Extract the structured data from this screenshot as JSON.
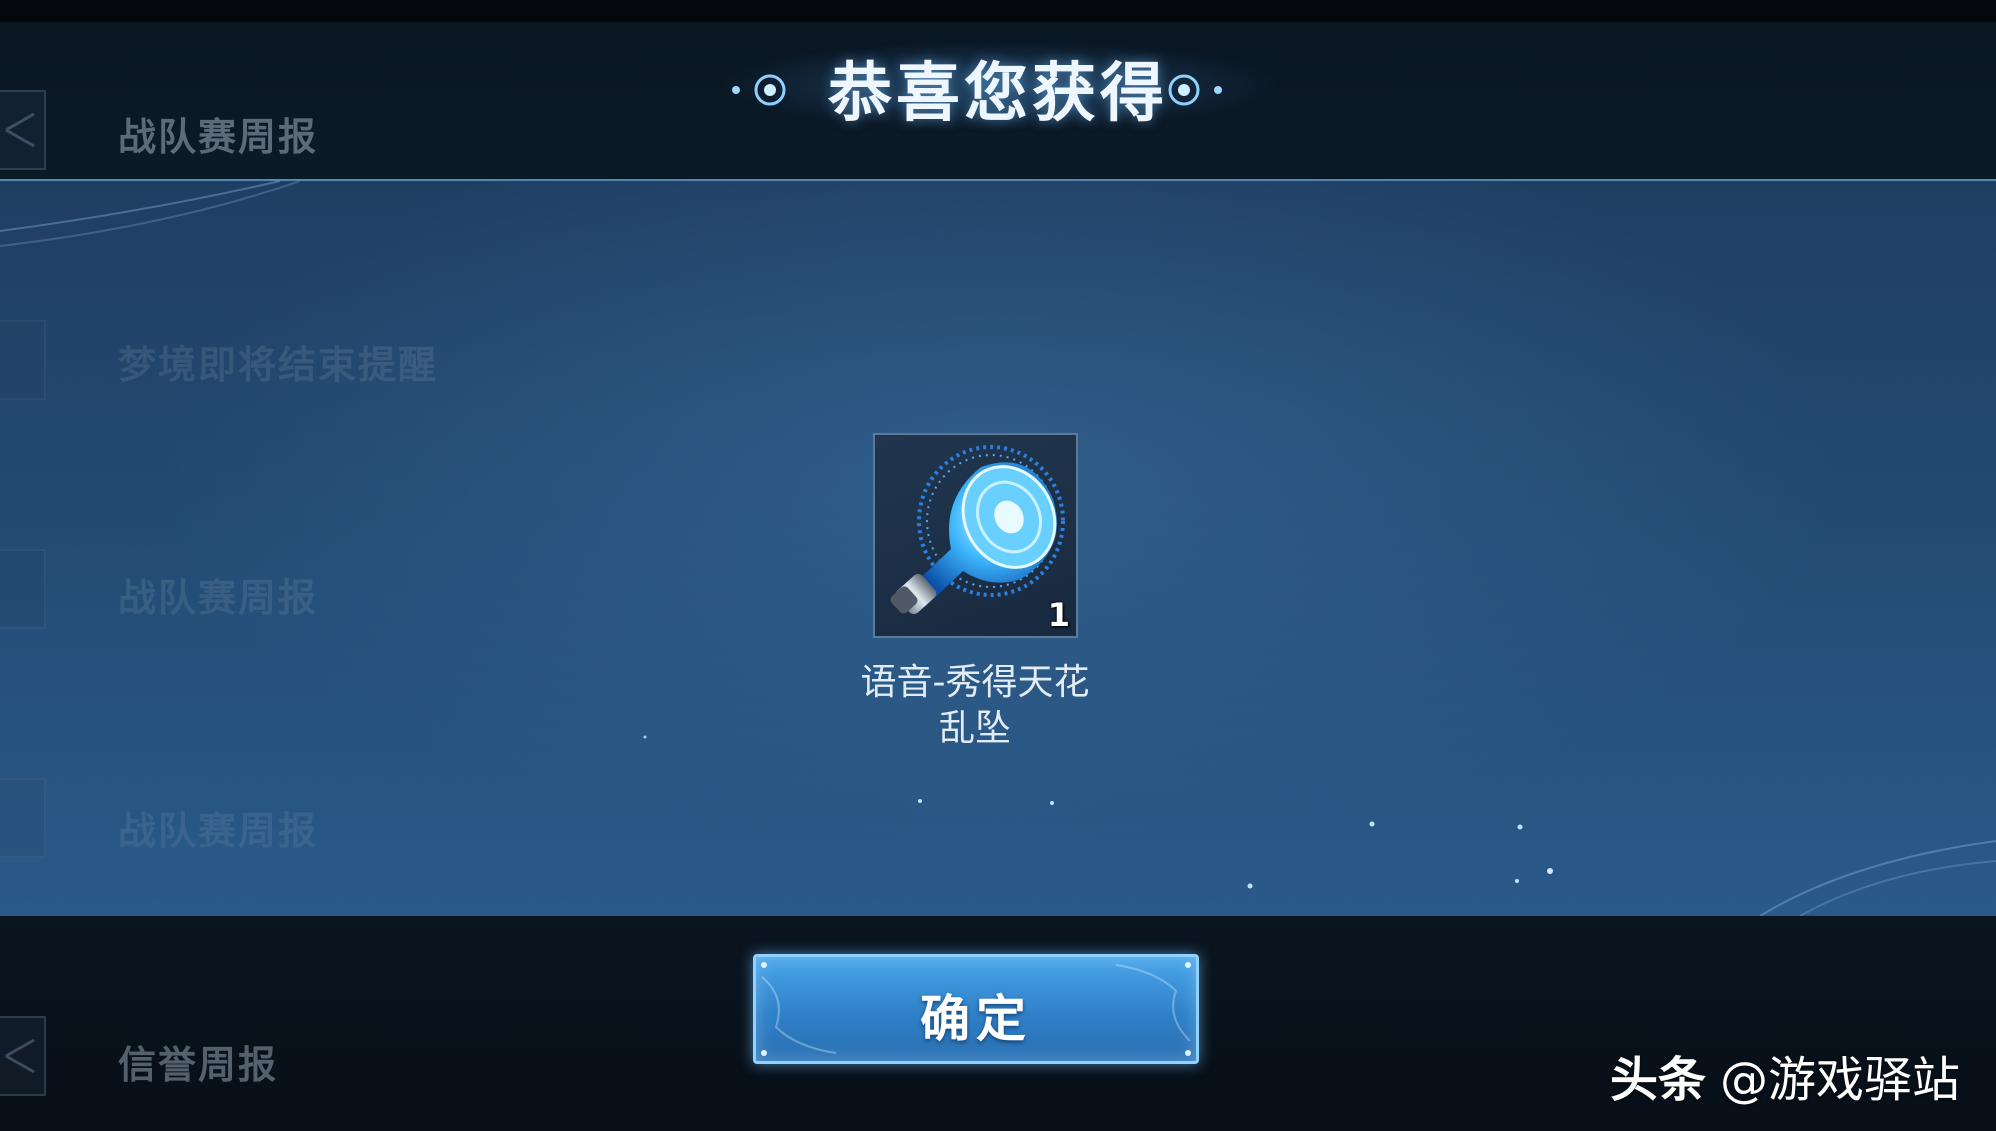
{
  "dialog": {
    "title": "恭喜您获得",
    "reward": {
      "name_line1": "语音-秀得天花",
      "name_line2": "乱坠",
      "count": "1",
      "icon": "speaker-horn-icon"
    },
    "confirm_label": "确定"
  },
  "background_list": {
    "items": [
      {
        "label": "战队赛周报"
      },
      {
        "label": "梦境即将结束提醒"
      },
      {
        "label": "战队赛周报"
      },
      {
        "label": "战队赛周报"
      },
      {
        "label": "信誉周报"
      }
    ]
  },
  "watermark": {
    "brand": "头条",
    "handle": "@游戏驿站"
  },
  "colors": {
    "panel": "#234a72",
    "button": "#3a90d8",
    "title_text": "#eef6ff"
  }
}
